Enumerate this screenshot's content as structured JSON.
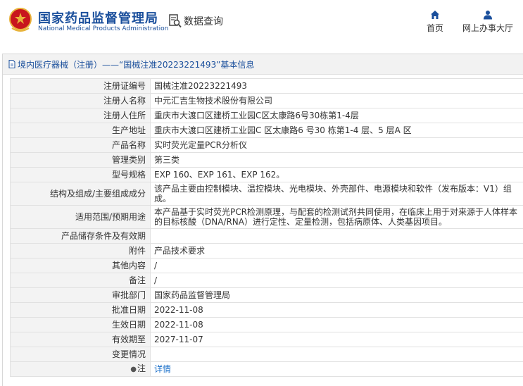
{
  "colors": {
    "brand_blue": "#1a4f9c",
    "header_bg": "#ffffff",
    "label_bg": "#f3f3f3",
    "link": "#1a6fc9",
    "emblem_red": "#c8161d",
    "emblem_gold": "#e8b33a"
  },
  "header": {
    "org_name_cn": "国家药品监督管理局",
    "org_name_en": "National Medical Products Administration",
    "query_icon": "search-document-icon",
    "query_label": "数据查询",
    "nav": [
      {
        "icon": "home-icon",
        "label": "首页"
      },
      {
        "icon": "user-icon",
        "label": "网上办事大厅"
      }
    ]
  },
  "panel": {
    "icon": "document-icon",
    "title": "境内医疗器械（注册）——“国械注准20223221493”基本信息"
  },
  "rows": [
    {
      "label": "注册证编号",
      "value": "国械注准20223221493"
    },
    {
      "label": "注册人名称",
      "value": "中元汇吉生物技术股份有限公司"
    },
    {
      "label": "注册人住所",
      "value": "重庆市大渡口区建桥工业园C区太康路6号30栋第1-4层"
    },
    {
      "label": "生产地址",
      "value": "重庆市大渡口区建桥工业园C 区太康路6 号30 栋第1-4 层、5 层A 区"
    },
    {
      "label": "产品名称",
      "value": "实时荧光定量PCR分析仪"
    },
    {
      "label": "管理类别",
      "value": "第三类"
    },
    {
      "label": "型号规格",
      "value": "EXP 160、EXP 161、EXP 162。"
    },
    {
      "label": "结构及组成/主要组成成分",
      "value": "该产品主要由控制模块、温控模块、光电模块、外壳部件、电源模块和软件（发布版本：V1）组成。"
    },
    {
      "label": "适用范围/预期用途",
      "value": "本产品基于实时荧光PCR检测原理，与配套的检测试剂共同使用，在临床上用于对来源于人体样本的目标核酸（DNA/RNA）进行定性、定量检测，包括病原体、人类基因项目。"
    },
    {
      "label": "产品储存条件及有效期",
      "value": ""
    },
    {
      "label": "附件",
      "value": "产品技术要求"
    },
    {
      "label": "其他内容",
      "value": "/"
    },
    {
      "label": "备注",
      "value": "/"
    },
    {
      "label": "审批部门",
      "value": "国家药品监督管理局"
    },
    {
      "label": "批准日期",
      "value": "2022-11-08"
    },
    {
      "label": "生效日期",
      "value": "2022-11-08"
    },
    {
      "label": "有效期至",
      "value": "2027-11-07"
    },
    {
      "label": "变更情况",
      "value": ""
    },
    {
      "label": "注",
      "icon": "pin-icon",
      "link_text": "详情"
    }
  ]
}
